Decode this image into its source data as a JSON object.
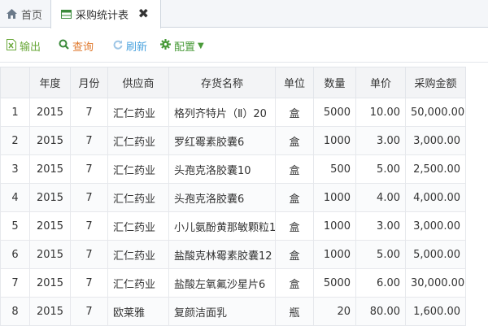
{
  "tabs": {
    "home_label": "首页",
    "active_label": "采购统计表",
    "close_glyph": "✖"
  },
  "toolbar": {
    "export_label": "输出",
    "query_label": "查询",
    "refresh_label": "刷新",
    "config_label": "配置"
  },
  "table": {
    "headers": [
      "",
      "年度",
      "月份",
      "供应商",
      "存货名称",
      "单位",
      "数量",
      "单价",
      "采购金额"
    ],
    "rows": [
      [
        "1",
        "2015",
        "7",
        "汇仁药业",
        "格列齐特片（Ⅱ）20",
        "盒",
        "5000",
        "10.00",
        "50,000.00"
      ],
      [
        "2",
        "2015",
        "7",
        "汇仁药业",
        "罗红霉素胶囊6",
        "盒",
        "1000",
        "3.00",
        "3,000.00"
      ],
      [
        "3",
        "2015",
        "7",
        "汇仁药业",
        "头孢克洛胶囊10",
        "盒",
        "500",
        "5.00",
        "2,500.00"
      ],
      [
        "4",
        "2015",
        "7",
        "汇仁药业",
        "头孢克洛胶囊6",
        "盒",
        "1000",
        "4.00",
        "4,000.00"
      ],
      [
        "5",
        "2015",
        "7",
        "汇仁药业",
        "小儿氨酚黄那敏颗粒10",
        "盒",
        "1000",
        "3.00",
        "3,000.00"
      ],
      [
        "6",
        "2015",
        "7",
        "汇仁药业",
        "盐酸克林霉素胶囊12",
        "盒",
        "1000",
        "5.00",
        "5,000.00"
      ],
      [
        "7",
        "2015",
        "7",
        "汇仁药业",
        "盐酸左氧氟沙星片6",
        "盒",
        "5000",
        "6.00",
        "30,000.00"
      ],
      [
        "8",
        "2015",
        "7",
        "欧莱雅",
        "复颜洁面乳",
        "瓶",
        "20",
        "80.00",
        "1,600.00"
      ]
    ]
  }
}
